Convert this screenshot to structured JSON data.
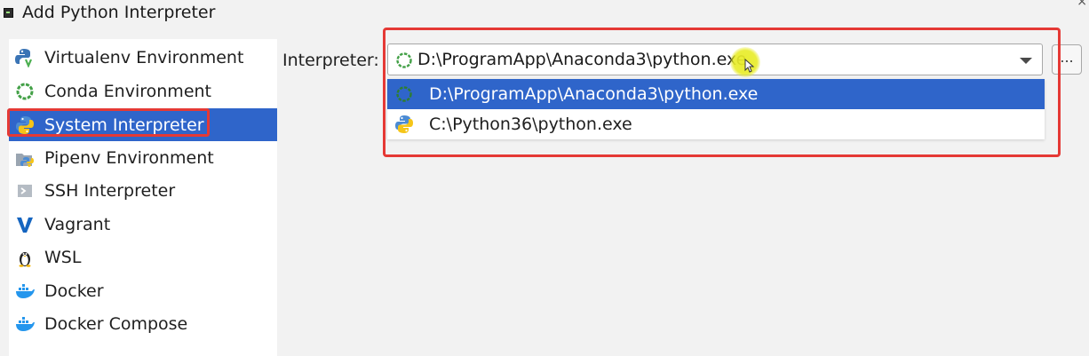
{
  "window": {
    "title": "Add Python Interpreter",
    "close_glyph": "×"
  },
  "sidebar": {
    "items": [
      {
        "label": "Virtualenv Environment",
        "icon": "virtualenv-icon",
        "selected": false
      },
      {
        "label": "Conda Environment",
        "icon": "conda-icon",
        "selected": false
      },
      {
        "label": "System Interpreter",
        "icon": "python-icon",
        "selected": true
      },
      {
        "label": "Pipenv Environment",
        "icon": "pipenv-icon",
        "selected": false
      },
      {
        "label": "SSH Interpreter",
        "icon": "ssh-terminal-icon",
        "selected": false
      },
      {
        "label": "Vagrant",
        "icon": "vagrant-icon",
        "selected": false
      },
      {
        "label": "WSL",
        "icon": "linux-penguin-icon",
        "selected": false
      },
      {
        "label": "Docker",
        "icon": "docker-icon",
        "selected": false
      },
      {
        "label": "Docker Compose",
        "icon": "docker-compose-icon",
        "selected": false
      }
    ]
  },
  "form": {
    "interpreter_label": "Interpreter:",
    "interpreter_value": "D:\\ProgramApp\\Anaconda3\\python.exe",
    "browse_label": "..."
  },
  "dropdown": {
    "options": [
      {
        "label": "D:\\ProgramApp\\Anaconda3\\python.exe",
        "icon": "conda-icon",
        "selected": true
      },
      {
        "label": "C:\\Python36\\python.exe",
        "icon": "python-icon",
        "selected": false
      }
    ]
  },
  "colors": {
    "selection": "#2f65ca",
    "annotation_red": "#e53935",
    "cursor_highlight": "#e8ec28"
  }
}
